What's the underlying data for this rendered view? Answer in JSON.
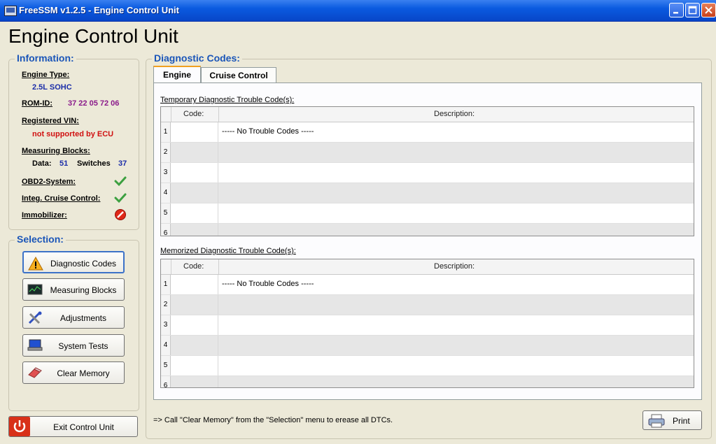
{
  "window": {
    "title": "FreeSSM v1.2.5 - Engine Control Unit"
  },
  "page_title": "Engine Control Unit",
  "information": {
    "title": "Information:",
    "engine_type_label": "Engine Type:",
    "engine_type_value": "2.5L SOHC",
    "romid_label": "ROM-ID:",
    "romid_value": "37 22 05 72 06",
    "vin_label": "Registered VIN:",
    "vin_value": "not supported by ECU",
    "measuring_blocks_label": "Measuring Blocks:",
    "data_label": "Data:",
    "data_value": "51",
    "switches_label": "Switches",
    "switches_value": "37",
    "obd2_label": "OBD2-System:",
    "cruise_label": "Integ. Cruise Control:",
    "immobilizer_label": "Immobilizer:"
  },
  "selection": {
    "title": "Selection:",
    "buttons": [
      "Diagnostic Codes",
      "Measuring Blocks",
      "Adjustments",
      "System Tests",
      "Clear Memory"
    ]
  },
  "diagnostic": {
    "title": "Diagnostic Codes:",
    "tabs": [
      "Engine",
      "Cruise Control"
    ],
    "temporary_label": "Temporary Diagnostic Trouble Code(s):",
    "memorized_label": "Memorized Diagnostic Trouble Code(s):",
    "col_code": "Code:",
    "col_description": "Description:",
    "row_numbers": [
      "1",
      "2",
      "3",
      "4",
      "5",
      "6"
    ],
    "no_codes": "----- No Trouble Codes -----"
  },
  "hint": "=> Call \"Clear Memory\" from the \"Selection\" menu to erease all DTCs.",
  "print_label": "Print",
  "exit_label": "Exit Control Unit",
  "colors": {
    "accent": "#1a55b8",
    "titlebar": "#0a5ae0",
    "warning": "#d01010"
  }
}
